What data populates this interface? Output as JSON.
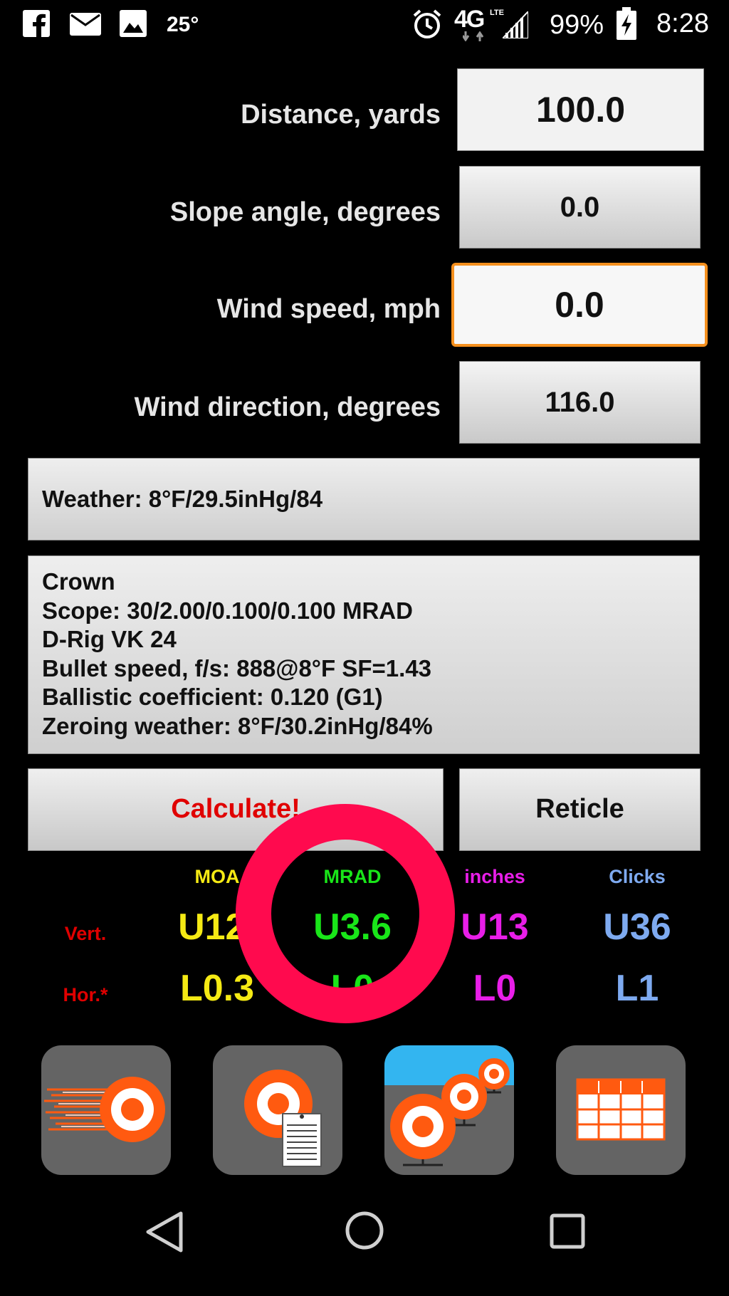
{
  "status": {
    "temperature": "25°",
    "network": "4G",
    "network_sub": "LTE",
    "battery": "99%",
    "time": "8:28"
  },
  "form": {
    "distance_label": "Distance, yards",
    "distance_value": "100.0",
    "slope_label": "Slope angle, degrees",
    "slope_value": "0.0",
    "wind_speed_label": "Wind speed, mph",
    "wind_speed_value": "0.0",
    "wind_dir_label": "Wind direction, degrees",
    "wind_dir_value": "116.0"
  },
  "weather": "Weather: 8°F/29.5inHg/84",
  "profile": {
    "lines": [
      "Crown",
      "Scope: 30/2.00/0.100/0.100 MRAD",
      "D-Rig VK 24",
      "Bullet speed, f/s: 888@8°F SF=1.43",
      "Ballistic coefficient: 0.120 (G1)",
      "Zeroing weather: 8°F/30.2inHg/84%"
    ]
  },
  "buttons": {
    "calculate": "Calculate!",
    "reticle": "Reticle"
  },
  "results": {
    "headers": {
      "moa": "MOA",
      "mrad": "MRAD",
      "inches": "inches",
      "clicks": "Clicks"
    },
    "vert_label": "Vert.",
    "hor_label": "Hor.*",
    "vert": {
      "moa": "U12.",
      "mrad": "U3.6",
      "inches": "U13",
      "clicks": "U36"
    },
    "hor": {
      "moa": "L0.3",
      "mrad": "L0",
      "inches": "L0",
      "clicks": "L1"
    }
  },
  "colors": {
    "moa": "#f5ea14",
    "mrad": "#19e619",
    "inches": "#e81ee8",
    "clicks": "#7eaaf0",
    "label_red": "#e00000",
    "calculate_red": "#e00000",
    "focus_orange": "#f5901e",
    "touch_ring": "#ff0a4e",
    "tool_orange": "#ff5a10"
  },
  "toolbar_icons": [
    "target-speed-icon",
    "target-document-icon",
    "multi-target-range-icon",
    "table-grid-icon"
  ]
}
